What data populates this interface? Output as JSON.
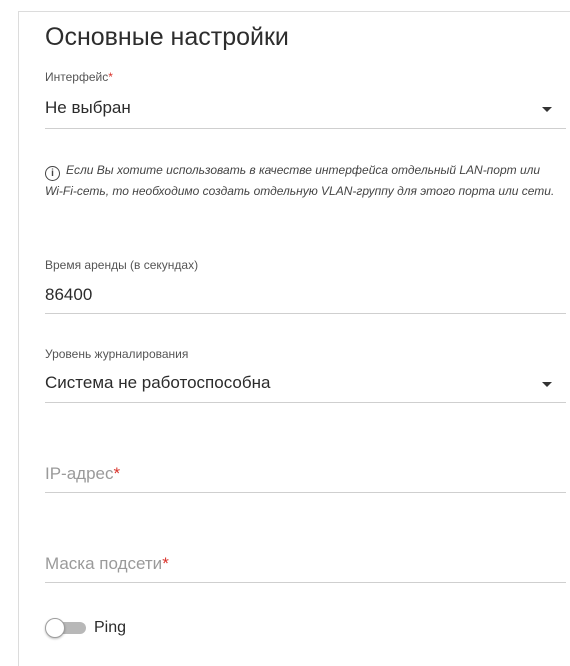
{
  "section": {
    "title": "Основные настройки"
  },
  "interface": {
    "label": "Интерфейс",
    "required_mark": "*",
    "value": "Не выбран"
  },
  "note": {
    "icon": "info-icon",
    "text": "Если Вы хотите использовать в качестве интерфейса отдельный LAN-порт или Wi-Fi-сеть, то необходимо создать отдельную VLAN-группу для этого порта или сети."
  },
  "lease_time": {
    "label": "Время аренды (в секундах)",
    "value": "86400"
  },
  "log_level": {
    "label": "Уровень журналирования",
    "value": "Система не работоспособна"
  },
  "ip_address": {
    "placeholder": "IP-адрес",
    "required_mark": "*"
  },
  "subnet_mask": {
    "placeholder": "Маска подсети",
    "required_mark": "*"
  },
  "ping": {
    "label": "Ping",
    "enabled": false
  },
  "colors": {
    "required": "#d9322a",
    "underline": "#cfcfcf",
    "placeholder": "#9a9a9a",
    "toggle_track_off": "#b8b8b8"
  }
}
